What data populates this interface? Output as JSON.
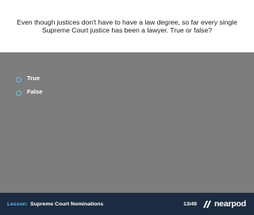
{
  "question": {
    "text": "Even though justices don't have to have a law degree, so far every single Supreme Court justice has been a lawyer. True or false?"
  },
  "answers": [
    {
      "label": "True"
    },
    {
      "label": "False"
    }
  ],
  "footer": {
    "lesson_prefix": "Lesson:",
    "lesson_title": "Supreme Court Nominations",
    "page_count": "13/49",
    "logo_text": "nearpod"
  },
  "colors": {
    "background": "#7d7d7d",
    "footer": "#1c2b3f",
    "accent": "#5ab4e0",
    "radio": "#5fc6d3"
  },
  "icons": {
    "logo": "nearpod-logo-icon"
  }
}
